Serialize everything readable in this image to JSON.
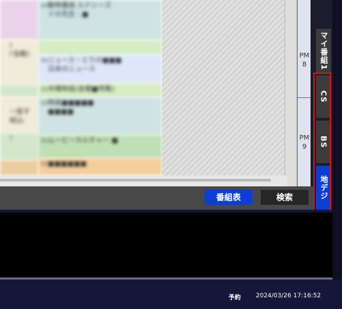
{
  "epg": {
    "columns": [
      {
        "cells": [
          {
            "color": "#ead3ea",
            "num": "",
            "lines": []
          },
          {
            "color": "#f1ecd9",
            "num": "",
            "lines": [
              "(",
              "l'自動)"
            ]
          },
          {
            "color": "#d4e7cb",
            "num": "",
            "lines": []
          },
          {
            "color": "#f1ecd9",
            "num": "",
            "lines": [
              "",
              "一般す",
              "組込:"
            ]
          },
          {
            "color": "#d4e7cb",
            "num": "",
            "lines": [
              "!"
            ]
          },
          {
            "color": "#ebcda2",
            "num": "",
            "lines": []
          }
        ]
      },
      {
        "cells": [
          {
            "color": "#cfe3e3",
            "num": "00",
            "lines": [
              "動物番組 ルドシーズ",
              "ドの先生 : ■"
            ]
          },
          {
            "color": "#d6ecc4",
            "num": "",
            "lines": []
          },
          {
            "color": "#dde7f7",
            "num": "00",
            "lines": [
              "ニュース・とりの■■■",
              "日本のニュース"
            ]
          },
          {
            "color": "#d6ecc4",
            "num": "00",
            "lines": [
              "木曜映画(金曜■特集)"
            ]
          },
          {
            "color": "#cfe3e3",
            "num": "00",
            "lines": [
              "映画■■■■■",
              "■■■■"
            ]
          },
          {
            "color": "#bfe0b6",
            "num": "00",
            "lines": [
              "ムービーカルチャー ■"
            ]
          },
          {
            "color": "#f4cf9c",
            "num": "00",
            "lines": [
              "■■■■■■"
            ]
          }
        ]
      }
    ]
  },
  "time_column": {
    "labels": [
      {
        "period": "PM",
        "hour": "8"
      },
      {
        "period": "PM",
        "hour": "9"
      }
    ]
  },
  "toolbar": {
    "epg_button": "番組表",
    "search_button": "検索"
  },
  "side_tabs": {
    "my_label": "マイ番組1",
    "cs_label": "CS",
    "bs_label": "BS",
    "chideji_label": "地デジ"
  },
  "status": {
    "reserve_label": "予約",
    "datetime": "2024/03/26 17:16:52"
  },
  "colors": {
    "accent_blue": "#0a3fd6",
    "highlight_red": "#e01010",
    "status_bar": "#14163a"
  }
}
